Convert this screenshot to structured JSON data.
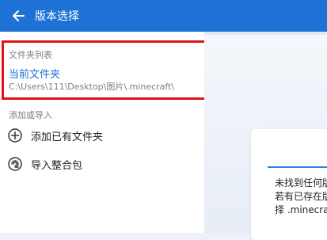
{
  "header": {
    "title": "版本选择"
  },
  "sidebar": {
    "folder_list_label": "文件夹列表",
    "current_folder_label": "当前文件夹",
    "current_folder_path": "C:\\Users\\111\\Desktop\\图片\\.minecraft\\",
    "add_import_label": "添加或导入",
    "items": [
      {
        "label": "添加已有文件夹",
        "icon": "plus-circle-icon"
      },
      {
        "label": "导入整合包",
        "icon": "package-icon"
      }
    ]
  },
  "main": {
    "message_lines": [
      "未找到任何版",
      "若有已存在版",
      "择 .minecraft"
    ]
  },
  "colors": {
    "accent": "#1e72d6",
    "highlight": "#e3121a"
  }
}
